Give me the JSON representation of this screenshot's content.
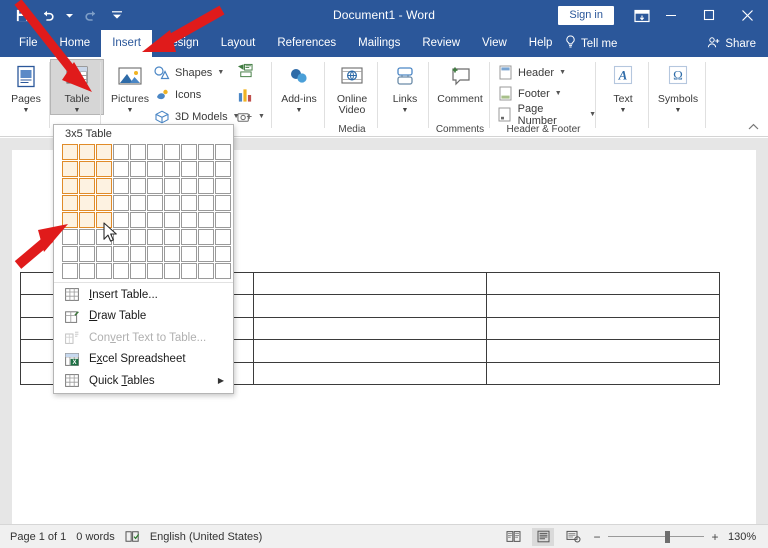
{
  "titlebar": {
    "document_title": "Document1  -  Word",
    "signin_label": "Sign in",
    "qat": [
      {
        "name": "save-icon",
        "label": "Save"
      },
      {
        "name": "undo-icon",
        "label": "Undo"
      },
      {
        "name": "redo-icon",
        "label": "Redo"
      },
      {
        "name": "customize-quick-access-toolbar-icon",
        "label": "Customize Quick Access Toolbar"
      }
    ],
    "window_buttons": [
      {
        "name": "ribbon-display-options-icon",
        "label": "Ribbon Display Options"
      },
      {
        "name": "minimize-icon",
        "label": "Minimize"
      },
      {
        "name": "maximize-icon",
        "label": "Maximize"
      },
      {
        "name": "close-icon",
        "label": "Close"
      }
    ]
  },
  "tabs": [
    {
      "label": "File",
      "active": false
    },
    {
      "label": "Home",
      "active": false
    },
    {
      "label": "Insert",
      "active": true
    },
    {
      "label": "Design",
      "active": false
    },
    {
      "label": "Layout",
      "active": false
    },
    {
      "label": "References",
      "active": false
    },
    {
      "label": "Mailings",
      "active": false
    },
    {
      "label": "Review",
      "active": false
    },
    {
      "label": "View",
      "active": false
    },
    {
      "label": "Help",
      "active": false
    }
  ],
  "tellme": {
    "label": "Tell me",
    "icon": "lightbulb-icon"
  },
  "share": {
    "label": "Share",
    "icon": "share-person-icon"
  },
  "ribbon": {
    "groups": [
      {
        "id": "pages",
        "label": "",
        "buttons": [
          {
            "label": "Pages",
            "icon": "pages-icon",
            "has_caret": true
          }
        ]
      },
      {
        "id": "tables",
        "label": "",
        "buttons": [
          {
            "label": "Table",
            "icon": "table-icon",
            "has_caret": true,
            "pressed": true
          }
        ]
      },
      {
        "id": "illustrations",
        "label": "",
        "buttons": [
          {
            "label": "Pictures",
            "icon": "pictures-icon",
            "has_caret": true
          }
        ],
        "small_items": [
          {
            "label": "Shapes",
            "icon": "shapes-icon",
            "has_caret": true
          },
          {
            "label": "Icons",
            "icon": "icons-icon",
            "has_caret": false
          },
          {
            "label": "3D Models",
            "icon": "3d-models-icon",
            "has_caret": true
          }
        ],
        "extra_icons": [
          {
            "name": "smartart-icon"
          },
          {
            "name": "chart-icon"
          },
          {
            "name": "screenshot-icon",
            "has_caret": true
          }
        ]
      },
      {
        "id": "addins",
        "label": "",
        "buttons": [
          {
            "label": "Add-ins",
            "icon": "add-ins-icon",
            "has_caret": true
          }
        ]
      },
      {
        "id": "media",
        "label": "Media",
        "buttons": [
          {
            "label": "Online Video",
            "icon": "online-video-icon",
            "has_caret": false
          }
        ]
      },
      {
        "id": "links",
        "label": "",
        "buttons": [
          {
            "label": "Links",
            "icon": "links-icon",
            "has_caret": true
          }
        ]
      },
      {
        "id": "comments",
        "label": "Comments",
        "buttons": [
          {
            "label": "Comment",
            "icon": "comment-icon",
            "has_caret": false
          }
        ]
      },
      {
        "id": "headerfooter",
        "label": "Header & Footer",
        "small_items": [
          {
            "label": "Header",
            "icon": "header-icon",
            "has_caret": true
          },
          {
            "label": "Footer",
            "icon": "footer-icon",
            "has_caret": true
          },
          {
            "label": "Page Number",
            "icon": "page-number-icon",
            "has_caret": true
          }
        ]
      },
      {
        "id": "text",
        "label": "",
        "buttons": [
          {
            "label": "Text",
            "icon": "text-icon",
            "has_caret": true
          }
        ]
      },
      {
        "id": "symbols",
        "label": "",
        "buttons": [
          {
            "label": "Symbols",
            "icon": "symbols-omega-icon",
            "has_caret": true
          }
        ]
      }
    ],
    "collapse_label": "Collapse the Ribbon"
  },
  "table_dropdown": {
    "header": "3x5 Table",
    "grid": {
      "columns": 10,
      "rows": 8,
      "selected_columns": 3,
      "selected_rows": 5
    },
    "menu_items": [
      {
        "label": "Insert Table...",
        "icon": "insert-table-icon",
        "disabled": false,
        "submenu": false
      },
      {
        "label": "Draw Table",
        "icon": "draw-table-icon",
        "disabled": false,
        "submenu": false
      },
      {
        "label": "Convert Text to Table...",
        "icon": "convert-text-to-table-icon",
        "disabled": true,
        "submenu": false
      },
      {
        "label": "Excel Spreadsheet",
        "icon": "excel-spreadsheet-icon",
        "disabled": false,
        "submenu": false
      },
      {
        "label": "Quick Tables",
        "icon": "quick-tables-icon",
        "disabled": false,
        "submenu": true
      }
    ]
  },
  "document": {
    "preview_table": {
      "columns": 3,
      "rows": 5
    }
  },
  "statusbar": {
    "page_info": "Page 1 of 1",
    "word_count": "0 words",
    "proofing_icon": "proofing-errors-icon",
    "language": "English (United States)",
    "views": [
      {
        "name": "read-mode-icon",
        "active": false
      },
      {
        "name": "print-layout-icon",
        "active": true
      },
      {
        "name": "web-layout-icon",
        "active": false
      }
    ],
    "zoom_out": "−",
    "zoom_in": "+",
    "zoom_level": "130%"
  },
  "annotations": {
    "arrows": [
      {
        "name": "arrow-to-table-button"
      },
      {
        "name": "arrow-to-insert-tab"
      },
      {
        "name": "arrow-to-grid-selection"
      }
    ],
    "color": "#E01B1B"
  },
  "colors": {
    "word_blue": "#2B579A",
    "selection_orange": "#E08B28",
    "selection_fill": "#FDF2E1",
    "arrow_red": "#E01B1B"
  }
}
